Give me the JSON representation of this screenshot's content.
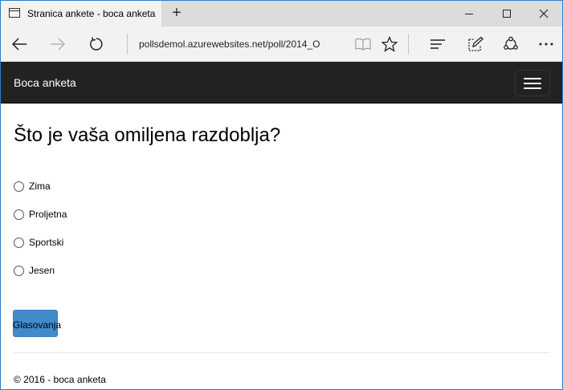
{
  "browser": {
    "tab_title": "Stranica ankete - boca anketa",
    "new_tab_glyph": "+",
    "url": "pollsdemol.azurewebsites.net/poll/2014_O",
    "icons": {
      "tab": "page-icon",
      "back": "back-arrow-icon",
      "forward": "forward-arrow-icon",
      "refresh": "refresh-icon",
      "reading_view": "book-icon",
      "favorite": "star-icon",
      "hub": "hub-icon",
      "web_note": "pen-icon",
      "share": "share-icon",
      "more": "more-icon",
      "minimize": "minimize-icon",
      "maximize": "maximize-icon",
      "close": "close-icon"
    }
  },
  "navbar": {
    "brand": "Boca anketa",
    "background": "#222222",
    "toggle_icon": "hamburger-menu-icon"
  },
  "poll": {
    "question": "Što je vaša omiljena razdoblja?",
    "choices": [
      {
        "label": "Zima"
      },
      {
        "label": "Proljetna"
      },
      {
        "label": "Sportski"
      },
      {
        "label": "Jesen"
      }
    ],
    "vote_label": "Glasovanja",
    "vote_color": "#428bca"
  },
  "footer": {
    "text": "© 2016 - boca anketa"
  }
}
